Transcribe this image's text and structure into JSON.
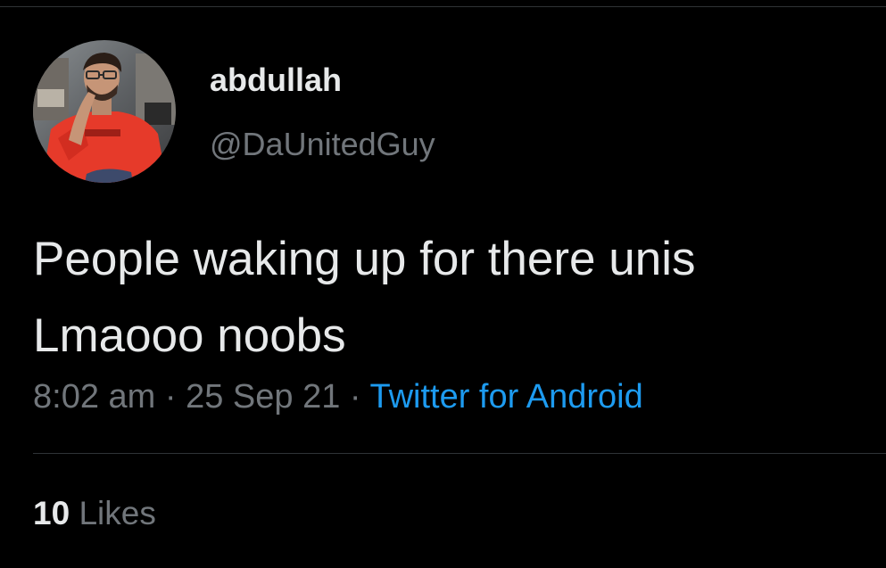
{
  "profile": {
    "display_name": "abdullah",
    "handle": "@DaUnitedGuy"
  },
  "tweet": {
    "text_lines": [
      "People waking up for there unis",
      "Lmaooo noobs"
    ],
    "time": "8:02 am",
    "separator": "·",
    "date": "25 Sep 21",
    "source": "Twitter for Android"
  },
  "stats": {
    "likes_count": "10",
    "likes_label": "Likes"
  },
  "colors": {
    "background": "#000000",
    "primary_text": "#e7e9ea",
    "secondary_text": "#71767b",
    "link": "#1d9bf0",
    "divider": "#2f3336"
  }
}
